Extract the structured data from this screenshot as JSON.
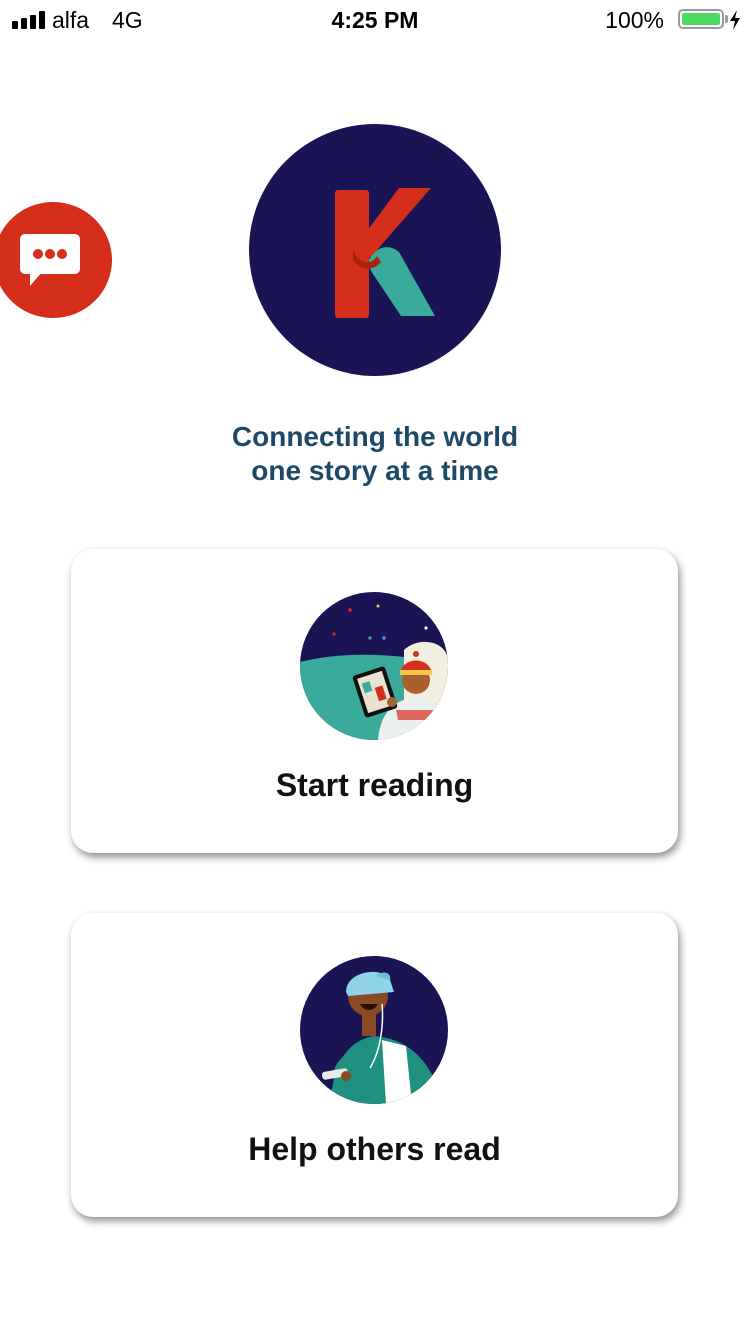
{
  "status_bar": {
    "carrier": "alfa",
    "network": "4G",
    "time": "4:25 PM",
    "battery_percent": "100%"
  },
  "chat": {
    "icon": "chat-bubble-icon"
  },
  "logo": {
    "letter": "K",
    "colors": {
      "background": "#1a1454",
      "red": "#d52e1b",
      "teal": "#3aab9a"
    }
  },
  "tagline": {
    "line1": "Connecting the world",
    "line2": "one story at a time"
  },
  "cards": {
    "start_reading": {
      "label": "Start reading"
    },
    "help_others": {
      "label": "Help others read"
    }
  }
}
